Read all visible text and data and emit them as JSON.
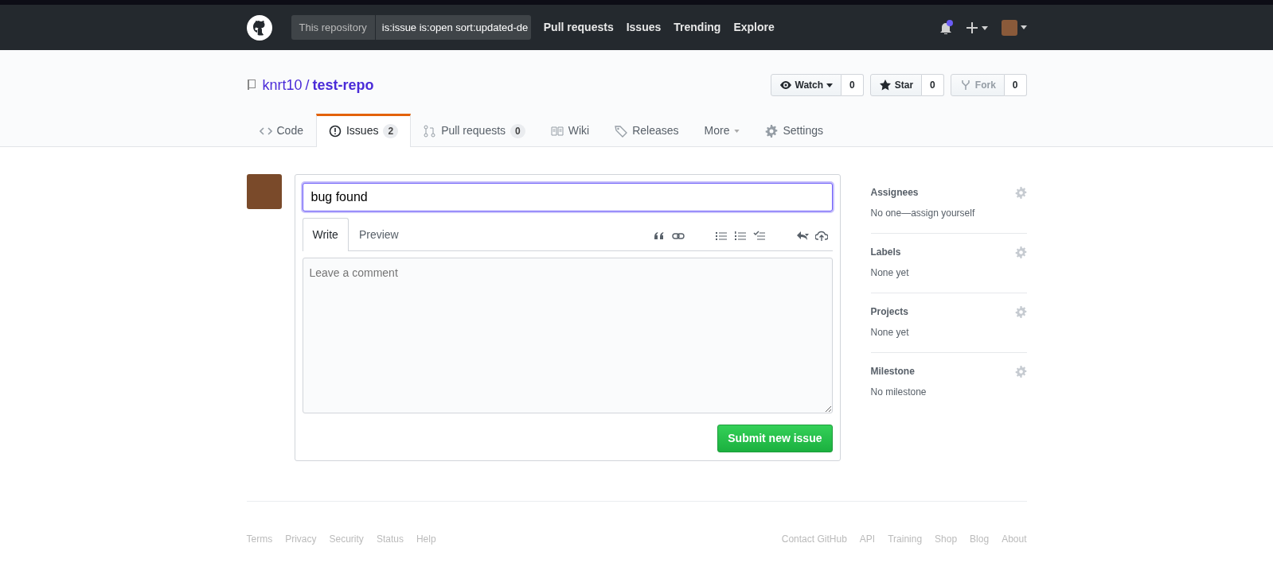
{
  "header": {
    "search_scope": "This repository",
    "search_value": "is:issue is:open sort:updated-de",
    "nav": [
      "Pull requests",
      "Issues",
      "Trending",
      "Explore"
    ],
    "notifications_unread": true
  },
  "repo": {
    "owner": "knrt10",
    "separator": "/",
    "name": "test-repo",
    "actions": [
      {
        "label": "Watch",
        "count": "0",
        "kind": "dropdown",
        "disabled": false
      },
      {
        "label": "Star",
        "count": "0",
        "kind": "star",
        "disabled": false
      },
      {
        "label": "Fork",
        "count": "0",
        "kind": "fork",
        "disabled": true
      }
    ]
  },
  "tabs": [
    {
      "label": "Code",
      "kind": "code",
      "selected": false
    },
    {
      "label": "Issues",
      "count": "2",
      "kind": "issues",
      "selected": true
    },
    {
      "label": "Pull requests",
      "count": "0",
      "kind": "pulls",
      "selected": false
    },
    {
      "label": "Wiki",
      "kind": "wiki",
      "selected": false
    },
    {
      "label": "Releases",
      "kind": "releases",
      "selected": false
    },
    {
      "label": "More",
      "kind": "more",
      "selected": false
    },
    {
      "label": "Settings",
      "kind": "settings",
      "selected": false
    }
  ],
  "issue_form": {
    "title_value": "bug found",
    "editor_tabs": [
      {
        "label": "Write",
        "selected": true
      },
      {
        "label": "Preview",
        "selected": false
      }
    ],
    "comment_placeholder": "Leave a comment",
    "submit": "Submit new issue"
  },
  "sidebar": [
    {
      "title": "Assignees",
      "value": "No one—assign yourself"
    },
    {
      "title": "Labels",
      "value": "None yet"
    },
    {
      "title": "Projects",
      "value": "None yet"
    },
    {
      "title": "Milestone",
      "value": "No milestone"
    }
  ],
  "footer": {
    "left": [
      "Terms",
      "Privacy",
      "Security",
      "Status",
      "Help"
    ],
    "right": [
      "Contact GitHub",
      "API",
      "Training",
      "Shop",
      "Blog",
      "About"
    ]
  }
}
